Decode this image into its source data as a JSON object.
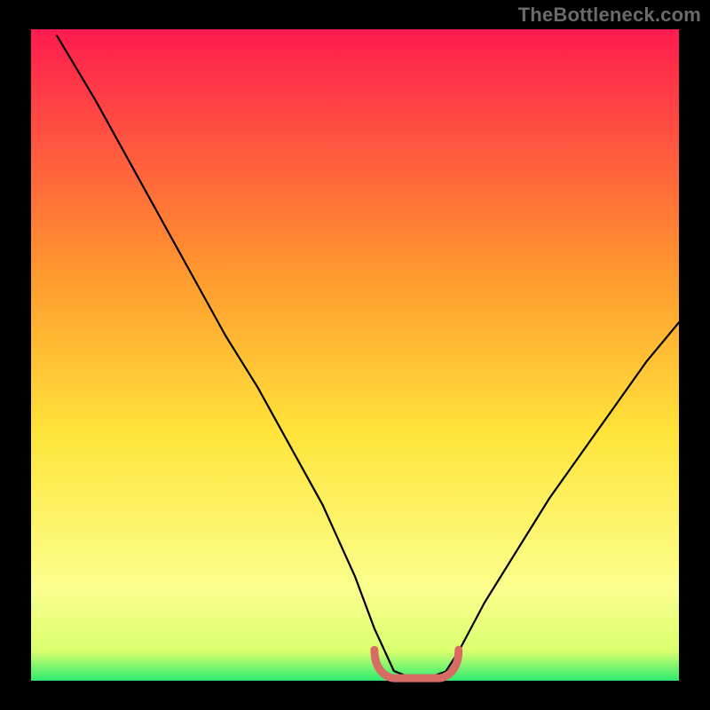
{
  "attribution": "TheBottleneck.com",
  "colors": {
    "bg": "#000000",
    "grad_top": "#ff1b4e",
    "grad_mid1": "#ff9a2e",
    "grad_mid2": "#ffe43a",
    "grad_low": "#fbff8e",
    "grad_bottom": "#2cec71",
    "curve": "#000000",
    "marker": "#d86b64",
    "attribution_text": "#6a6a6a"
  },
  "chart_data": {
    "type": "line",
    "title": "",
    "xlabel": "",
    "ylabel": "",
    "xlim": [
      0,
      100
    ],
    "ylim": [
      0,
      100
    ],
    "series": [
      {
        "name": "bottleneck-curve",
        "values_note": "Approx. percentage bottleneck vs. x position. Read from curve shape; y=100 near top-left, y=0 at valley (~x=55-63), rising toward ~55 at x=100.",
        "x": [
          4,
          10,
          15,
          20,
          25,
          30,
          35,
          40,
          45,
          50,
          53,
          56,
          58,
          60,
          62,
          64,
          66,
          70,
          75,
          80,
          85,
          90,
          95,
          100
        ],
        "values": [
          99,
          89,
          80,
          71,
          62,
          53,
          45,
          36,
          27,
          16,
          8,
          1.5,
          0.7,
          0.6,
          0.7,
          1.4,
          4.5,
          12,
          20,
          28,
          35,
          42,
          49,
          55
        ]
      }
    ],
    "optimal_band": {
      "x_start": 53,
      "x_end": 66,
      "y": 1.2
    },
    "gradient_stops": [
      {
        "offset": 0.0,
        "color": "#ff1b4e"
      },
      {
        "offset": 0.38,
        "color": "#ff9a2e"
      },
      {
        "offset": 0.62,
        "color": "#ffe43a"
      },
      {
        "offset": 0.86,
        "color": "#fbff8e"
      },
      {
        "offset": 0.955,
        "color": "#d9ff6e"
      },
      {
        "offset": 1.0,
        "color": "#2cec71"
      }
    ]
  },
  "layout": {
    "inner_x": 35,
    "inner_y": 33,
    "inner_w": 730,
    "inner_h": 734
  }
}
